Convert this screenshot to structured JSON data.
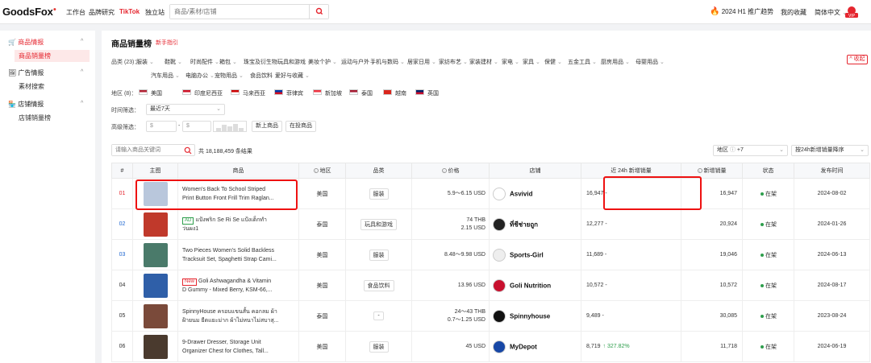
{
  "header": {
    "logo": "GoodsFox",
    "nav": [
      "工作台",
      "品牌研究",
      "TikTok",
      "独立站"
    ],
    "search_placeholder": "商品/素材/店铺",
    "trend": "2024 H1 推广趋势",
    "favorites": "我的收藏",
    "language": "简体中文",
    "vip": "VIP"
  },
  "sidebar": {
    "groups": [
      {
        "label": "商品情报",
        "items": [
          "商品销量榜"
        ]
      },
      {
        "label": "广告情报",
        "items": [
          "素材搜索"
        ]
      },
      {
        "label": "店铺情报",
        "items": [
          "店铺销量榜"
        ]
      }
    ]
  },
  "main": {
    "title": "商品销量榜",
    "guide": "新手指引",
    "category_label": "品类 (23)：",
    "categories_row1": [
      "服装",
      "鞋靴",
      "时尚配件",
      "箱包",
      "珠宝及衍生物",
      "玩具和游戏",
      "美妆个护",
      "运动与户外",
      "手机与数码",
      "居家日用",
      "家纺布艺",
      "家装建材",
      "家电",
      "家具",
      "保健",
      "五金工具",
      "厨房用品",
      "母婴用品"
    ],
    "categories_row2": [
      "汽车用品",
      "电脑办公",
      "宠物用品",
      "食品饮料",
      "爱好与收藏"
    ],
    "collapse": "收起",
    "region_label": "地区 (8)：",
    "regions": [
      "美国",
      "印度尼西亚",
      "马来西亚",
      "菲律宾",
      "新加坡",
      "泰国",
      "越南",
      "英国"
    ],
    "time_label": "时间筛选：",
    "time_value": "最近7天",
    "advanced_label": "高级筛选：",
    "currency_symbol": "$",
    "range_dash": "-",
    "new_products": "新上商品",
    "on_sale": "在投商品",
    "list_search_placeholder": "请输入商品关键词",
    "total": "共 18,188,459 条结果",
    "region_filter": "地区",
    "region_filter_value": "+7",
    "sort_value": "按24h新增销量降序"
  },
  "table": {
    "headers": [
      "#",
      "主图",
      "商品",
      "地区",
      "品类",
      "价格",
      "店铺",
      "近 24h 新增销量",
      "新增销量",
      "状态",
      "发布时间"
    ],
    "rows": [
      {
        "rank": "01",
        "title1": "Women's Back To School Striped",
        "title2": "Print Button Front Frill Trim Raglan...",
        "badge": "",
        "region": "美国",
        "category": "服装",
        "price1": "5.9～6.15 USD",
        "price2": "",
        "shop": "Asvivid",
        "sales24": "16,947 -",
        "growth": "",
        "newsales": "16,947",
        "status": "在架",
        "date": "2024-08-02"
      },
      {
        "rank": "02",
        "title1": "แป้งพริก Se Ri Se แป้งเด็กทำ",
        "title2": "ว่นผง1",
        "badge": "AD",
        "region": "泰国",
        "category": "玩具和游戏",
        "price1": "74 THB",
        "price2": "2.15 USD",
        "shop": "ที่ชีช่ายถูก",
        "sales24": "12,277 -",
        "growth": "",
        "newsales": "20,924",
        "status": "在架",
        "date": "2024-01-26"
      },
      {
        "rank": "03",
        "title1": "Two Pieces Women's Solid Backless",
        "title2": "Tracksuit Set, Spaghetti Strap Cami...",
        "badge": "",
        "region": "美国",
        "category": "服装",
        "price1": "8.48～9.98 USD",
        "price2": "",
        "shop": "Sports-Girl",
        "sales24": "11,689 -",
        "growth": "",
        "newsales": "19,046",
        "status": "在架",
        "date": "2024-06-13"
      },
      {
        "rank": "04",
        "title1": "Goli Ashwagandha & Vitamin",
        "title2": "D Gummy - Mixed Berry, KSM-66,...",
        "badge": "New",
        "region": "美国",
        "category": "食品饮料",
        "price1": "13.96 USD",
        "price2": "",
        "shop": "Goli Nutrition",
        "sales24": "10,572 -",
        "growth": "",
        "newsales": "10,572",
        "status": "在架",
        "date": "2024-08-17"
      },
      {
        "rank": "05",
        "title1": "SpinnyHouse ครอบแขนสั้น คอกลม ผ้า",
        "title2": "ฝ้ายนม ยืดแยะม่าก ผ้าไม่หนาไม่สบาสุ...",
        "badge": "",
        "region": "泰国",
        "category": "-",
        "price1": "24～43 THB",
        "price2": "0.7～1.25 USD",
        "shop": "Spinnyhouse",
        "sales24": "9,489 -",
        "growth": "",
        "newsales": "30,085",
        "status": "在架",
        "date": "2023-08-24"
      },
      {
        "rank": "06",
        "title1": "9-Drawer Dresser, Storage Unit",
        "title2": "Organizer Chest for Clothes, Tall...",
        "badge": "",
        "region": "美国",
        "category": "服装",
        "price1": "45 USD",
        "price2": "",
        "shop": "MyDepot",
        "sales24": "8,719",
        "growth": "↑ 327.82%",
        "newsales": "11,718",
        "status": "在架",
        "date": "2024-06-19"
      }
    ]
  }
}
